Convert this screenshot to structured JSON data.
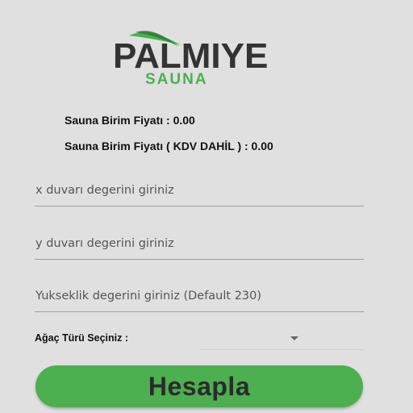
{
  "logo": {
    "brand": "PALMIYE",
    "sub": "SAUNA",
    "colors": {
      "dark": "#333333",
      "green": "#4caf50"
    }
  },
  "prices": {
    "unit_price": "Sauna Birim Fiyatı : 0.00",
    "unit_price_vat": "Sauna Birim Fiyatı ( KDV DAHİL ) : 0.00"
  },
  "inputs": {
    "x_wall": {
      "placeholder": "x duvarı degerini giriniz",
      "value": ""
    },
    "y_wall": {
      "placeholder": "y duvarı degerini giriniz",
      "value": ""
    },
    "height": {
      "placeholder": "Yukseklik degerini giriniz (Default 230)",
      "value": ""
    }
  },
  "tree": {
    "label": "Ağaç Türü Seçiniz :",
    "selected": "",
    "icon": "chevron-down-icon"
  },
  "actions": {
    "calculate_label": "Hesapla",
    "button_color": "#4caf50"
  }
}
